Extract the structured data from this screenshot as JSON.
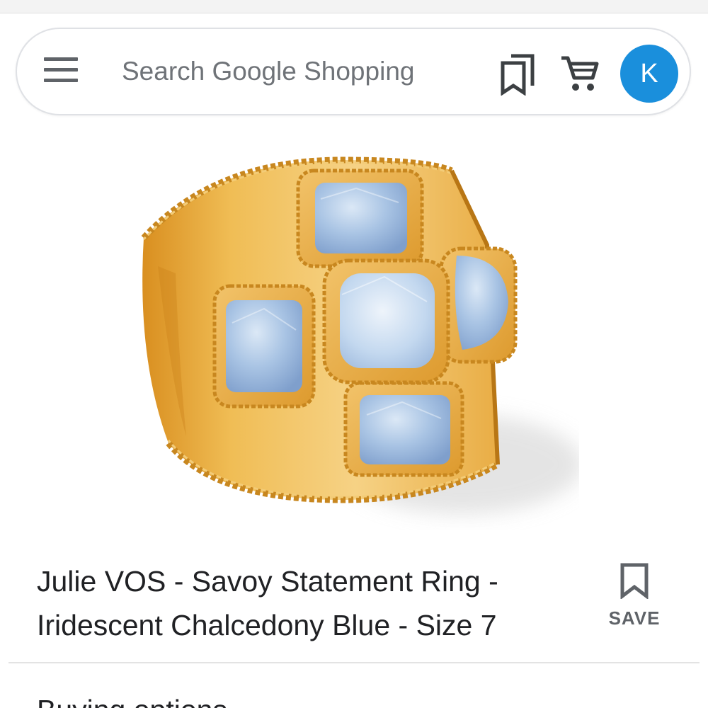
{
  "search": {
    "placeholder": "Search Google Shopping"
  },
  "header": {
    "menu_icon": "hamburger-menu-icon",
    "saved_icon": "bookmarks-icon",
    "cart_icon": "shopping-cart-icon",
    "avatar_initial": "K",
    "avatar_color": "#1a8fdc"
  },
  "product": {
    "image_alt": "ring-product-image",
    "title_line1": "Julie VOS - Savoy Statement Ring -",
    "title_line2": "Iridescent Chalcedony Blue - Size 7",
    "save_label": "SAVE",
    "save_icon": "bookmark-icon"
  },
  "sections": {
    "buying_options": "Buying options"
  },
  "colors": {
    "gold": "#e3a83a",
    "stone_blue": "#a8c6e6"
  }
}
